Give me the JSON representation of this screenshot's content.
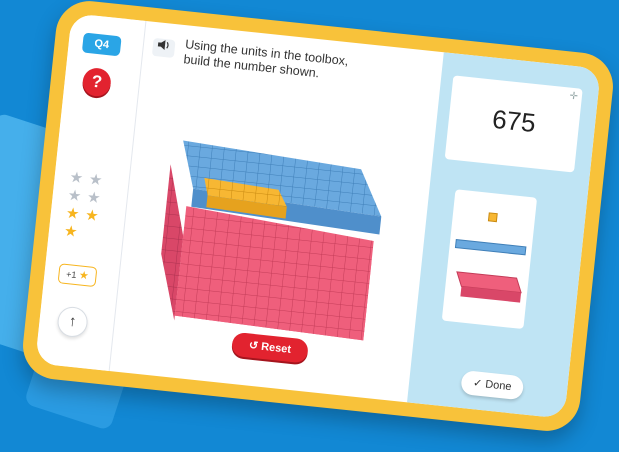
{
  "question": {
    "badge": "Q4",
    "help": "?",
    "prompt_line1": "Using the units in the toolbox,",
    "prompt_line2": "build the number shown."
  },
  "rail": {
    "bonus_label": "+1",
    "up_symbol": "↑"
  },
  "stars": {
    "grey": 4,
    "gold": 3
  },
  "buttons": {
    "reset": "Reset",
    "done": "Done"
  },
  "target": {
    "number": "675"
  },
  "toolbox": {
    "items": [
      "unit cube",
      "ten rod",
      "hundred flat"
    ]
  },
  "icons": {
    "speaker": "speaker-icon",
    "reset": "undo-icon",
    "done": "checkmark-icon",
    "up": "arrow-up-icon",
    "resize": "resize-icon"
  },
  "colors": {
    "background": "#1288d4",
    "frame": "#f8c23a",
    "red": "#e2232f",
    "blue": "#6aa9df",
    "pink": "#ef5f7c",
    "yellow": "#f7b733",
    "panel": "#bfe4f4"
  }
}
